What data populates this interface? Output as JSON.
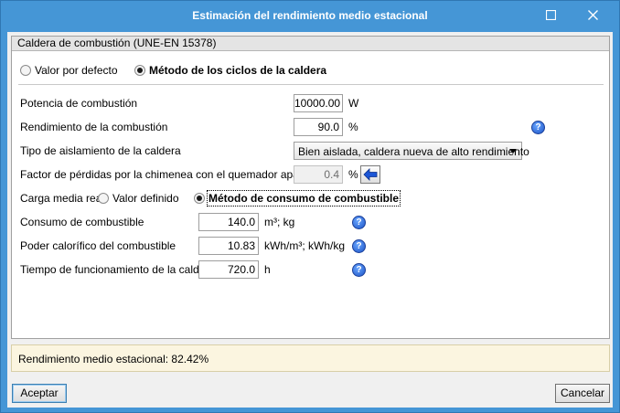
{
  "window": {
    "title": "Estimación del rendimiento medio estacional",
    "maximize_icon": "maximize-icon",
    "close_icon": "close-icon"
  },
  "group": {
    "header": "Caldera de combustión (UNE-EN 15378)",
    "mode_options": [
      {
        "label": "Valor por defecto",
        "checked": false
      },
      {
        "label": "Método de los ciclos de la caldera",
        "checked": true
      }
    ]
  },
  "fields": {
    "potencia": {
      "label": "Potencia de combustión",
      "value": "10000.00",
      "unit": "W"
    },
    "rendimiento": {
      "label": "Rendimiento de la combustión",
      "value": "90.0",
      "unit": "%"
    },
    "aislamiento": {
      "label": "Tipo de aislamiento de la caldera",
      "selected": "Bien aislada, caldera nueva de alto rendimiento"
    },
    "factor": {
      "label": "Factor de pérdidas por la chimenea con el quemador apagado",
      "value": "0.4",
      "unit": "%"
    },
    "carga": {
      "label": "Carga media real",
      "options": [
        {
          "label": "Valor definido",
          "checked": false
        },
        {
          "label": "Método de consumo de combustible",
          "checked": true
        }
      ]
    },
    "consumo": {
      "label": "Consumo de combustible",
      "value": "140.0",
      "unit": "m³; kg"
    },
    "poder": {
      "label": "Poder calorífico del combustible",
      "value": "10.83",
      "unit": "kWh/m³; kWh/kg"
    },
    "tiempo": {
      "label": "Tiempo de funcionamiento de la caldera",
      "value": "720.0",
      "unit": "h"
    }
  },
  "result": {
    "text": "Rendimiento medio estacional: 82.42%"
  },
  "buttons": {
    "accept": "Aceptar",
    "cancel": "Cancelar"
  },
  "colors": {
    "titlebar": "#4596d6",
    "result_bg": "#fbf5e0",
    "help_icon": "#1c53c6"
  }
}
